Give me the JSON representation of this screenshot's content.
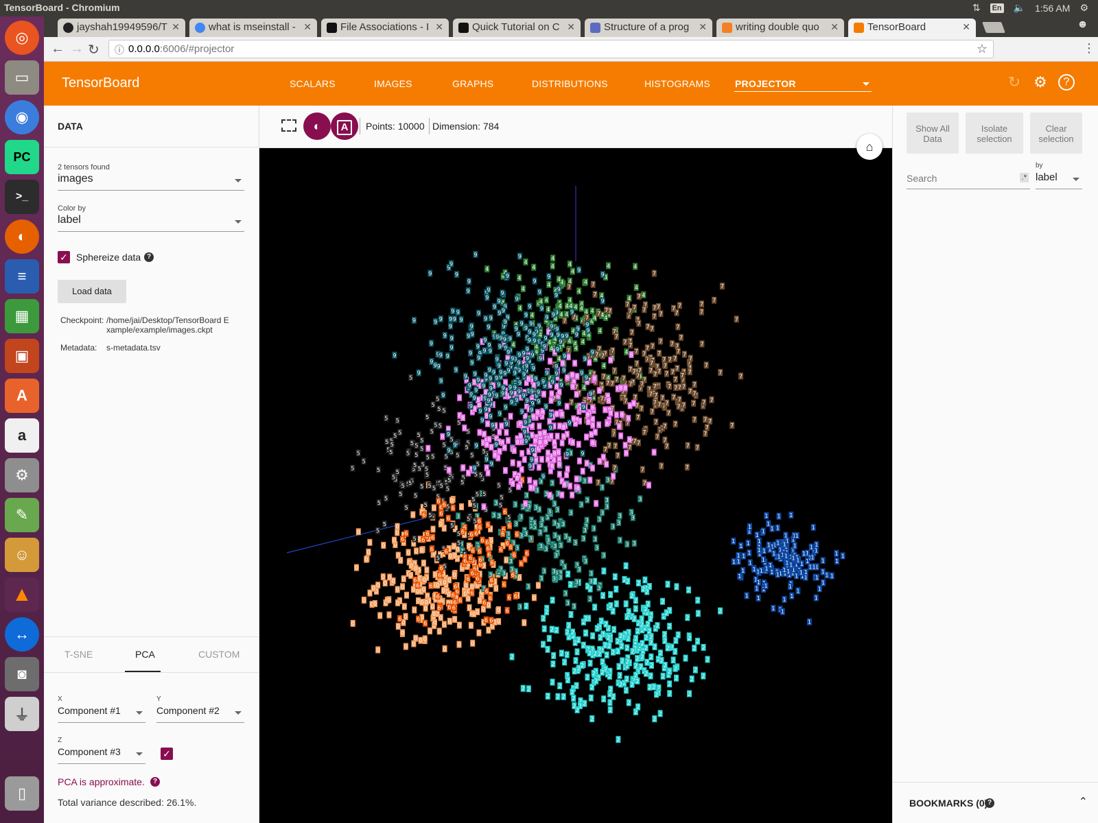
{
  "os": {
    "window_title": "TensorBoard - Chromium",
    "keyboard_layout": "En",
    "clock": "1:56 AM"
  },
  "browser": {
    "tabs": [
      {
        "label": "jayshah19949596/T",
        "favicon_color": "#222222"
      },
      {
        "label": "what is mseinstall -",
        "favicon_color": "#4285f4"
      },
      {
        "label": "File Associations - I",
        "favicon_color": "#111111"
      },
      {
        "label": "Quick Tutorial on C",
        "favicon_color": "#111111"
      },
      {
        "label": "Structure of a prog",
        "favicon_color": "#5c6bc0"
      },
      {
        "label": "writing double quo",
        "favicon_color": "#f48024"
      },
      {
        "label": "TensorBoard",
        "favicon_color": "#f57c00"
      }
    ],
    "url_host": "0.0.0.0",
    "url_path": ":6006/#projector"
  },
  "tensorboard": {
    "brand": "TensorBoard",
    "nav": [
      "SCALARS",
      "IMAGES",
      "GRAPHS",
      "DISTRIBUTIONS",
      "HISTOGRAMS",
      "PROJECTOR"
    ],
    "accent": "#f57c00"
  },
  "left_panel": {
    "section_title": "DATA",
    "tensors_found": "2 tensors found",
    "tensor_select": "images",
    "color_by_label": "Color by",
    "color_by_value": "label",
    "sphereize_label": "Sphereize data",
    "sphereize_checked": true,
    "load_button": "Load data",
    "checkpoint_key": "Checkpoint:",
    "checkpoint_value_1": "/home/jai/Desktop/TensorBoard E",
    "checkpoint_value_2": "xample/example/images.ckpt",
    "metadata_key": "Metadata:",
    "metadata_value": "s-metadata.tsv",
    "method_tabs": [
      "T-SNE",
      "PCA",
      "CUSTOM"
    ],
    "active_method": "PCA",
    "x_label": "X",
    "x_value": "Component #1",
    "y_label": "Y",
    "y_value": "Component #2",
    "z_label": "Z",
    "z_value": "Component #3",
    "pca_note": "PCA is approximate.",
    "variance_text": "Total variance described: 26.1%."
  },
  "toolbar": {
    "points_text": "Points: 10000",
    "dimension_text": "Dimension: 784"
  },
  "right_panel": {
    "show_all": [
      "Show All",
      "Data"
    ],
    "isolate": [
      "Isolate",
      "selection"
    ],
    "clear": [
      "Clear",
      "selection"
    ],
    "search_placeholder": "Search",
    "regex_glyph": ".*",
    "by_label": "by",
    "by_value": "label",
    "bookmarks": "BOOKMARKS (0)"
  },
  "scatter_colors": {
    "0": "#f39c5b",
    "1": "#0d47a1",
    "2": "#26d0ce",
    "3": "#1c7a6c",
    "4": "#2e7d32",
    "5": "#222222",
    "6": "#e65100",
    "7": "#6d4c2f",
    "8": "#e066e0",
    "9": "#0b5563"
  }
}
